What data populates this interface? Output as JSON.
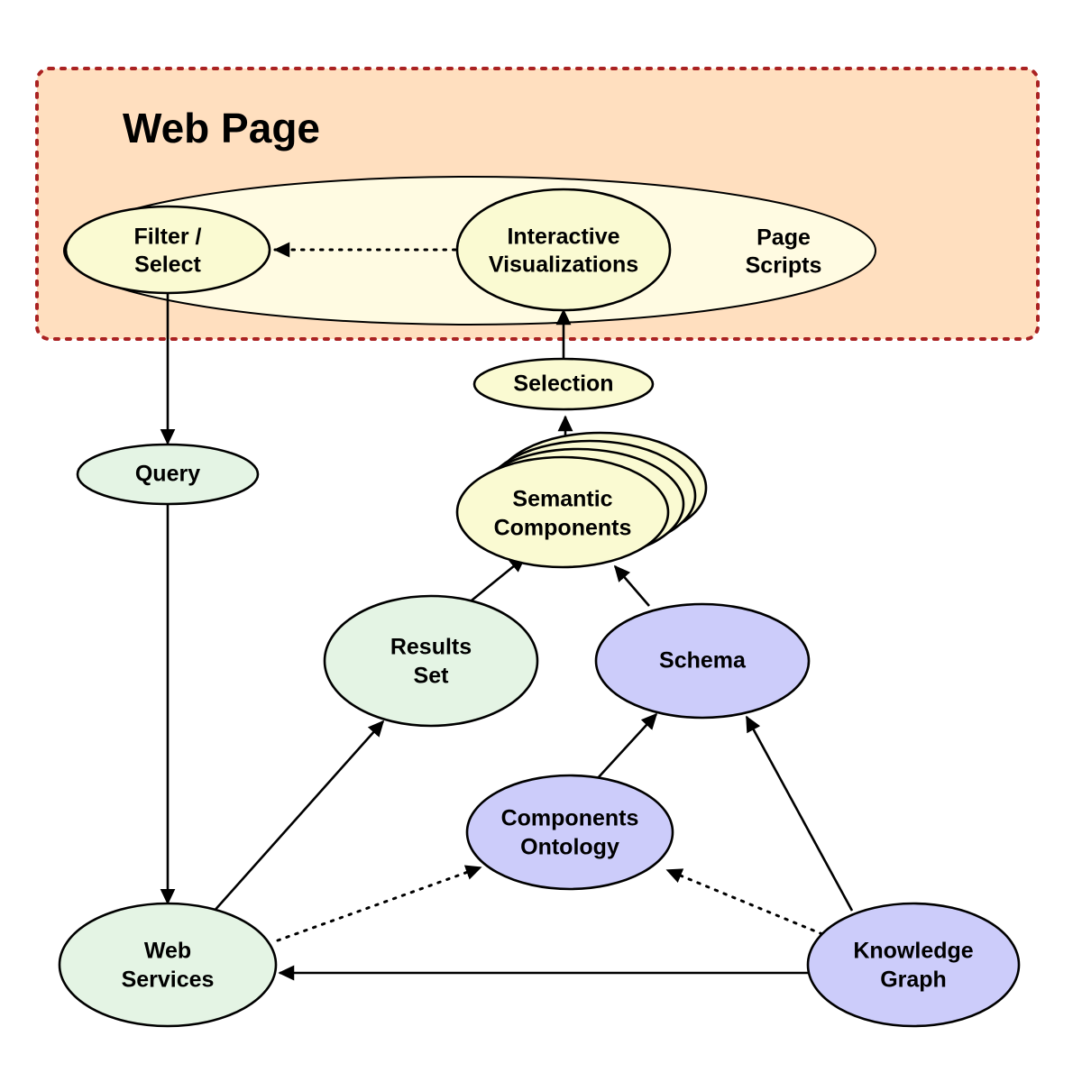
{
  "diagram": {
    "title": "Web Page architecture diagram",
    "container": {
      "label": "Web Page",
      "fill": "#ffdfbf",
      "border_color": "#aa2222",
      "border_style": "dotted"
    },
    "colors": {
      "yellow_fill": "#fafad2",
      "cream_fill": "#fffbe2",
      "green_fill": "#e4f4e4",
      "purple_fill": "#ccccfa",
      "peach_fill": "#ffdfbf",
      "stroke": "#000000",
      "container_border": "#aa2222"
    },
    "nodes": [
      {
        "id": "page_scripts",
        "label": "Page Scripts",
        "fill": "#fffbe2",
        "shape": "ellipse"
      },
      {
        "id": "filter_select",
        "label": "Filter / Select",
        "fill": "#fafad2",
        "shape": "ellipse"
      },
      {
        "id": "interactive_vis",
        "label": "Interactive Visualizations",
        "fill": "#fafad2",
        "shape": "ellipse"
      },
      {
        "id": "selection",
        "label": "Selection",
        "fill": "#fafad2",
        "shape": "ellipse"
      },
      {
        "id": "semantic_components",
        "label": "Semantic Components",
        "fill": "#fafad2",
        "shape": "ellipse-stack"
      },
      {
        "id": "query",
        "label": "Query",
        "fill": "#e4f4e4",
        "shape": "ellipse"
      },
      {
        "id": "results_set",
        "label": "Results Set",
        "fill": "#e4f4e4",
        "shape": "ellipse"
      },
      {
        "id": "schema",
        "label": "Schema",
        "fill": "#ccccfa",
        "shape": "ellipse"
      },
      {
        "id": "components_ontology",
        "label": "Components Ontology",
        "fill": "#ccccfa",
        "shape": "ellipse"
      },
      {
        "id": "web_services",
        "label": "Web Services",
        "fill": "#e4f4e4",
        "shape": "ellipse"
      },
      {
        "id": "knowledge_graph",
        "label": "Knowledge Graph",
        "fill": "#ccccfa",
        "shape": "ellipse"
      }
    ],
    "node_labels": {
      "page_scripts_line1": "Page",
      "page_scripts_line2": "Scripts",
      "filter_select_line1": "Filter /",
      "filter_select_line2": "Select",
      "interactive_vis_line1": "Interactive",
      "interactive_vis_line2": "Visualizations",
      "selection": "Selection",
      "semantic_components_line1": "Semantic",
      "semantic_components_line2": "Components",
      "query": "Query",
      "results_set_line1": "Results",
      "results_set_line2": "Set",
      "schema": "Schema",
      "components_ontology_line1": "Components",
      "components_ontology_line2": "Ontology",
      "web_services_line1": "Web",
      "web_services_line2": "Services",
      "knowledge_graph_line1": "Knowledge",
      "knowledge_graph_line2": "Graph"
    },
    "edges": [
      {
        "id": "vis_to_filter",
        "from": "interactive_vis",
        "to": "filter_select",
        "style": "dotted"
      },
      {
        "id": "filter_to_query",
        "from": "filter_select",
        "to": "query",
        "style": "solid"
      },
      {
        "id": "query_to_webservices",
        "from": "query",
        "to": "web_services",
        "style": "solid"
      },
      {
        "id": "selection_to_vis",
        "from": "selection",
        "to": "interactive_vis",
        "style": "solid"
      },
      {
        "id": "semantic_to_selection",
        "from": "semantic_components",
        "to": "selection",
        "style": "solid"
      },
      {
        "id": "results_to_semantic",
        "from": "results_set",
        "to": "semantic_components",
        "style": "solid"
      },
      {
        "id": "schema_to_semantic",
        "from": "schema",
        "to": "semantic_components",
        "style": "solid"
      },
      {
        "id": "webservices_to_results",
        "from": "web_services",
        "to": "results_set",
        "style": "solid"
      },
      {
        "id": "ontology_to_schema",
        "from": "components_ontology",
        "to": "schema",
        "style": "solid"
      },
      {
        "id": "kg_to_schema",
        "from": "knowledge_graph",
        "to": "schema",
        "style": "solid"
      },
      {
        "id": "webservices_to_ontology",
        "from": "web_services",
        "to": "components_ontology",
        "style": "dotted"
      },
      {
        "id": "kg_to_ontology",
        "from": "knowledge_graph",
        "to": "components_ontology",
        "style": "dotted"
      },
      {
        "id": "kg_to_webservices",
        "from": "knowledge_graph",
        "to": "web_services",
        "style": "solid"
      }
    ]
  }
}
